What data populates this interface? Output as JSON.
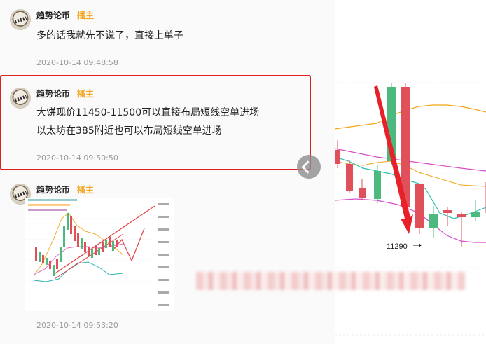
{
  "messages": [
    {
      "author": "趋势论币",
      "badge": "播主",
      "lines": [
        "多的话我就先不说了，直接上单子"
      ],
      "time": "2020-10-14 09:48:58"
    },
    {
      "author": "趋势论币",
      "badge": "播主",
      "lines": [
        "大饼现价11450-11500可以直接布局短线空单进场",
        "以太坊在385附近也可以布局短线空单进场"
      ],
      "time": "2020-10-14 09:50:50"
    },
    {
      "author": "趋势论币",
      "badge": "播主",
      "image": "chart-thumbnail",
      "time": "2020-10-14 09:53:20"
    }
  ],
  "main_chart": {
    "price_label": "11290"
  },
  "colors": {
    "up": "#4cb97e",
    "down": "#e0505a",
    "highlight": "#e02020",
    "badge": "#f5a623"
  }
}
